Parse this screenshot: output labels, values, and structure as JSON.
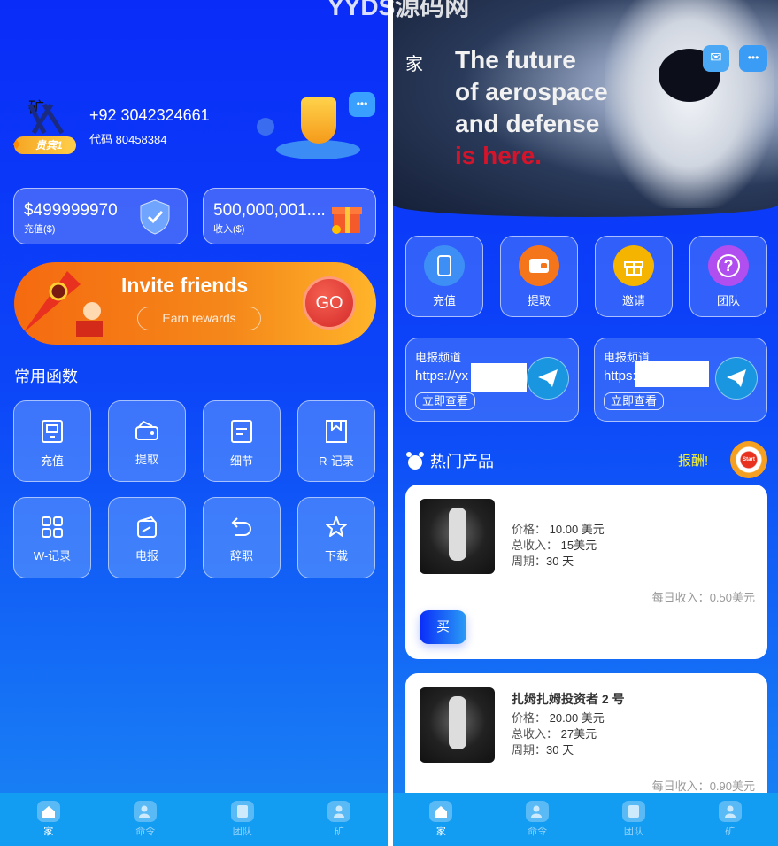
{
  "watermark": "YYDS源码网",
  "left": {
    "avatar_text": "矿",
    "vip_badge": "贵宾1",
    "phone": "+92 3042324661",
    "code_label": "代码",
    "code": "80458384",
    "balances": [
      {
        "value": "$499999970",
        "label": "充值($)"
      },
      {
        "value": "500,000,001....",
        "label": "收入($)"
      }
    ],
    "invite_banner": {
      "title": "Invite friends",
      "subtitle": "Earn rewards",
      "go": "GO"
    },
    "section_title": "常用函数",
    "functions": [
      {
        "label": "充值",
        "icon": "recharge-icon"
      },
      {
        "label": "提取",
        "icon": "wallet-icon"
      },
      {
        "label": "细节",
        "icon": "document-icon"
      },
      {
        "label": "R-记录",
        "icon": "bookmark-icon"
      },
      {
        "label": "W-记录",
        "icon": "grid-icon"
      },
      {
        "label": "电报",
        "icon": "card-icon"
      },
      {
        "label": "辞职",
        "icon": "undo-icon"
      },
      {
        "label": "下载",
        "icon": "star-icon"
      }
    ]
  },
  "right": {
    "home_label": "家",
    "banner_lines": [
      "The future",
      "of aerospace",
      "and defense",
      "is here."
    ],
    "quick": [
      {
        "label": "充值",
        "icon": "phone-icon",
        "color": "#3d8ef5"
      },
      {
        "label": "提取",
        "icon": "wallet-icon",
        "color": "#f5751a"
      },
      {
        "label": "邀请",
        "icon": "gift-icon",
        "color": "#f5b400"
      },
      {
        "label": "团队",
        "icon": "help-icon",
        "color": "#b04ef0"
      }
    ],
    "channels": [
      {
        "title": "电报频道",
        "url": "https://yx",
        "button": "立即查看"
      },
      {
        "title": "电报频道",
        "url": "https:",
        "button": "立即查看"
      }
    ],
    "hot_title": "热门产品",
    "reward_label": "报酬!",
    "start_label": "Start",
    "products": [
      {
        "name": "",
        "price_label": "价格：",
        "price": "10.00 美元",
        "total_label": "总收入：",
        "total": "15美元",
        "period_label": "周期：",
        "period": "30 天",
        "daily_label": "每日收入：",
        "daily": "0.50美元",
        "buy": "买"
      },
      {
        "name": "扎姆扎姆投资者 2 号",
        "price_label": "价格：",
        "price": "20.00 美元",
        "total_label": "总收入：",
        "total": "27美元",
        "period_label": "周期：",
        "period": "30 天",
        "daily_label": "每日收入：",
        "daily": "0.90美元"
      }
    ]
  },
  "nav": [
    {
      "label": "家",
      "icon": "home-icon"
    },
    {
      "label": "命令",
      "icon": "add-user-icon"
    },
    {
      "label": "团队",
      "icon": "list-icon"
    },
    {
      "label": "矿",
      "icon": "user-icon"
    }
  ]
}
